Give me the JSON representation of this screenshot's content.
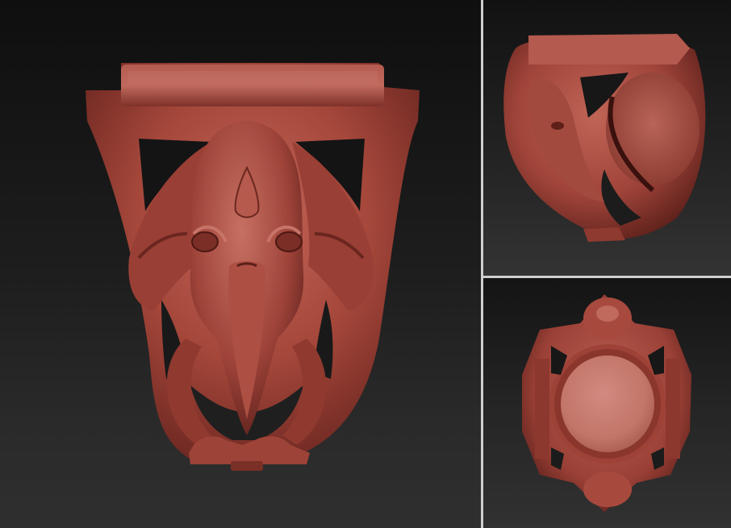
{
  "image": {
    "subject": "",
    "colors": {
      "clay": "#a9483c",
      "clay_light": "#c86a5c",
      "clay_dark": "#6e2720",
      "clay_shadow": "#4a1712",
      "background_top": "#0f0f0f",
      "background_bottom": "#303030",
      "divider": "#cfcfcf"
    }
  }
}
